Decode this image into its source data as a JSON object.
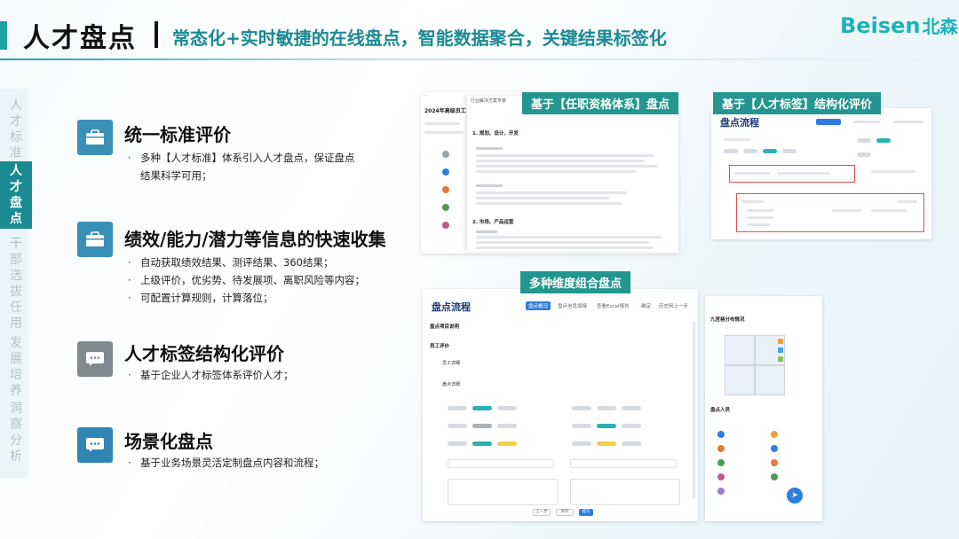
{
  "header": {
    "title": "人才盘点",
    "subtitle": "常态化+实时敏捷的在线盘点，智能数据聚合，关键结果标签化",
    "logo_en": "Beisen",
    "logo_cn": "北森"
  },
  "sidenav": {
    "items": [
      {
        "label": "人才标准",
        "active": false
      },
      {
        "label": "人才盘点",
        "active": true
      },
      {
        "label": "干部选拔任用",
        "active": false
      },
      {
        "label": "发展培养",
        "active": false
      },
      {
        "label": "洞察分析",
        "active": false
      }
    ]
  },
  "features": [
    {
      "icon": "briefcase-icon",
      "title": "统一标准评价",
      "bullets": [
        "多种【人才标准】体系引入人才盘点，保证盘点结果科学可用；"
      ]
    },
    {
      "icon": "briefcase-icon",
      "title": "绩效/能力/潜力等信息的快速收集",
      "bullets": [
        "自动获取绩效结果、测评结果、360结果；",
        "上级评价，优劣势、待发展项、离职风险等内容；",
        "可配置计算规则，计算落位；"
      ]
    },
    {
      "icon": "chat-icon",
      "title": "人才标签结构化评价",
      "bullets": [
        "基于企业人才标签体系评价人才；"
      ]
    },
    {
      "icon": "chat-icon",
      "title": "场景化盘点",
      "bullets": [
        "基于业务场景灵活定制盘点内容和流程；"
      ]
    }
  ],
  "panels": {
    "p1": {
      "label": "基于【任职资格体系】盘点",
      "doc_title": "2024年高级员工",
      "tab_header": "行业解决方案专家",
      "section1": "1. 规划、设计、开发",
      "section2": "2. 市场、产品运营"
    },
    "p2": {
      "label": "基于【人才标签】结构化评价",
      "heading": "盘点流程"
    },
    "p3": {
      "label": "多种维度组合盘点",
      "heading": "盘点流程",
      "tabs": [
        "盘点概况",
        "盘点信息填报",
        "查看Excel报告",
        "确定",
        "历史网上一步"
      ],
      "section_a": "盘点项目说明",
      "section_b": "员工评价",
      "sub_a": "员工详细",
      "sub_b": "盘点详细",
      "right_title": "九宫格分布情况",
      "right_list_title": "盘点人员",
      "buttons": {
        "prev": "上一步",
        "save": "保存",
        "submit": "提交"
      }
    }
  },
  "colors": {
    "accent": "#1fa2a8",
    "subtitle": "#1b8a93",
    "label_bg": "#23978f",
    "icon_blue": "#3a8fb7",
    "icon_gray": "#7f8a90",
    "nav_active": "#1b8a93"
  }
}
